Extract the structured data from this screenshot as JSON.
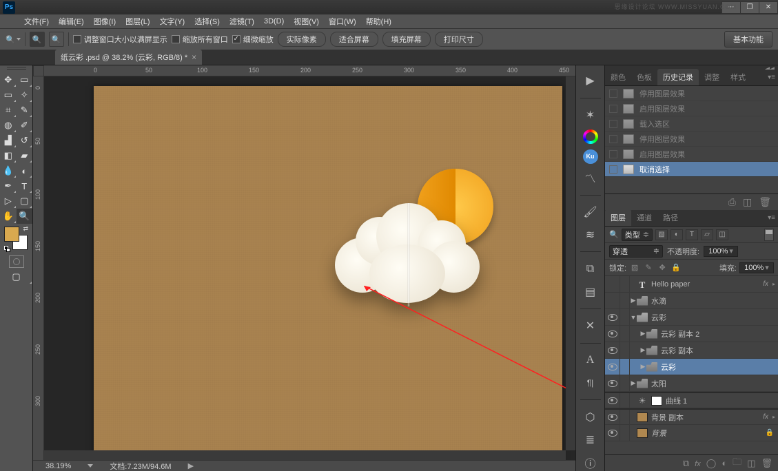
{
  "watermark": "思缘设计论坛  WWW.MISSYUAN.COM",
  "app_logo": "Ps",
  "menubar": [
    "文件(F)",
    "编辑(E)",
    "图像(I)",
    "图层(L)",
    "文字(Y)",
    "选择(S)",
    "滤镜(T)",
    "3D(D)",
    "视图(V)",
    "窗口(W)",
    "帮助(H)"
  ],
  "options": {
    "fit_window": "调整窗口大小以满屏显示",
    "zoom_all": "缩放所有窗口",
    "scrubby": "细微缩放",
    "buttons": [
      "实际像素",
      "适合屏幕",
      "填充屏幕",
      "打印尺寸"
    ],
    "basic": "基本功能"
  },
  "document": {
    "tab": "纸云彩 .psd @ 38.2% (云彩, RGB/8) *",
    "zoom_display": "38.19%",
    "doc_size": "文档:7.23M/94.6M"
  },
  "ruler_h": [
    "0",
    "50",
    "100",
    "150",
    "200",
    "250",
    "300",
    "350",
    "400",
    "450"
  ],
  "ruler_v": [
    "0",
    "50",
    "100",
    "150",
    "200",
    "250",
    "300"
  ],
  "colors": {
    "foreground": "#d9a94f",
    "background": "#ffffff",
    "canvas": "#a8824f"
  },
  "panels": {
    "top_tabs": [
      "颜色",
      "色板",
      "历史记录",
      "调整",
      "样式"
    ],
    "top_active": 2,
    "history": [
      {
        "label": "停用图层效果",
        "dim": true
      },
      {
        "label": "启用图层效果",
        "dim": true
      },
      {
        "label": "载入选区",
        "dim": true
      },
      {
        "label": "停用图层效果",
        "dim": true
      },
      {
        "label": "启用图层效果",
        "dim": true
      },
      {
        "label": "取消选择",
        "sel": true
      }
    ],
    "layer_tabs": [
      "图层",
      "通道",
      "路径"
    ],
    "layer_tabs_active": 0,
    "filter_kind": "类型",
    "blend_mode": "穿透",
    "opacity_label": "不透明度:",
    "opacity_value": "100%",
    "lock_label": "锁定:",
    "fill_label": "填充:",
    "fill_value": "100%",
    "layers": [
      {
        "type": "text",
        "name": "Hello paper",
        "eye": false,
        "fx": true,
        "indent": 0
      },
      {
        "type": "folder",
        "name": "水滴",
        "eye": false,
        "twisty": "▶",
        "indent": 0
      },
      {
        "type": "folder",
        "name": "云彩",
        "eye": true,
        "twisty": "▼",
        "indent": 0,
        "open": true
      },
      {
        "type": "folder",
        "name": "云彩 副本 2",
        "eye": true,
        "twisty": "▶",
        "indent": 1,
        "sel": false
      },
      {
        "type": "folder",
        "name": "云彩 副本",
        "eye": true,
        "twisty": "▶",
        "indent": 1
      },
      {
        "type": "folder",
        "name": "云彩",
        "eye": true,
        "twisty": "▶",
        "indent": 1,
        "sel": true
      },
      {
        "type": "folder",
        "name": "太阳",
        "eye": true,
        "twisty": "▶",
        "indent": 0
      },
      {
        "type": "adjustment",
        "name": "曲线 1",
        "eye": true,
        "indent": 0,
        "divider": true
      },
      {
        "type": "pixel",
        "name": "背景 副本",
        "eye": true,
        "fx": true,
        "indent": 0,
        "divider": true
      },
      {
        "type": "pixel",
        "name": "背景",
        "eye": true,
        "indent": 0,
        "locked": true,
        "italic": true
      }
    ]
  }
}
